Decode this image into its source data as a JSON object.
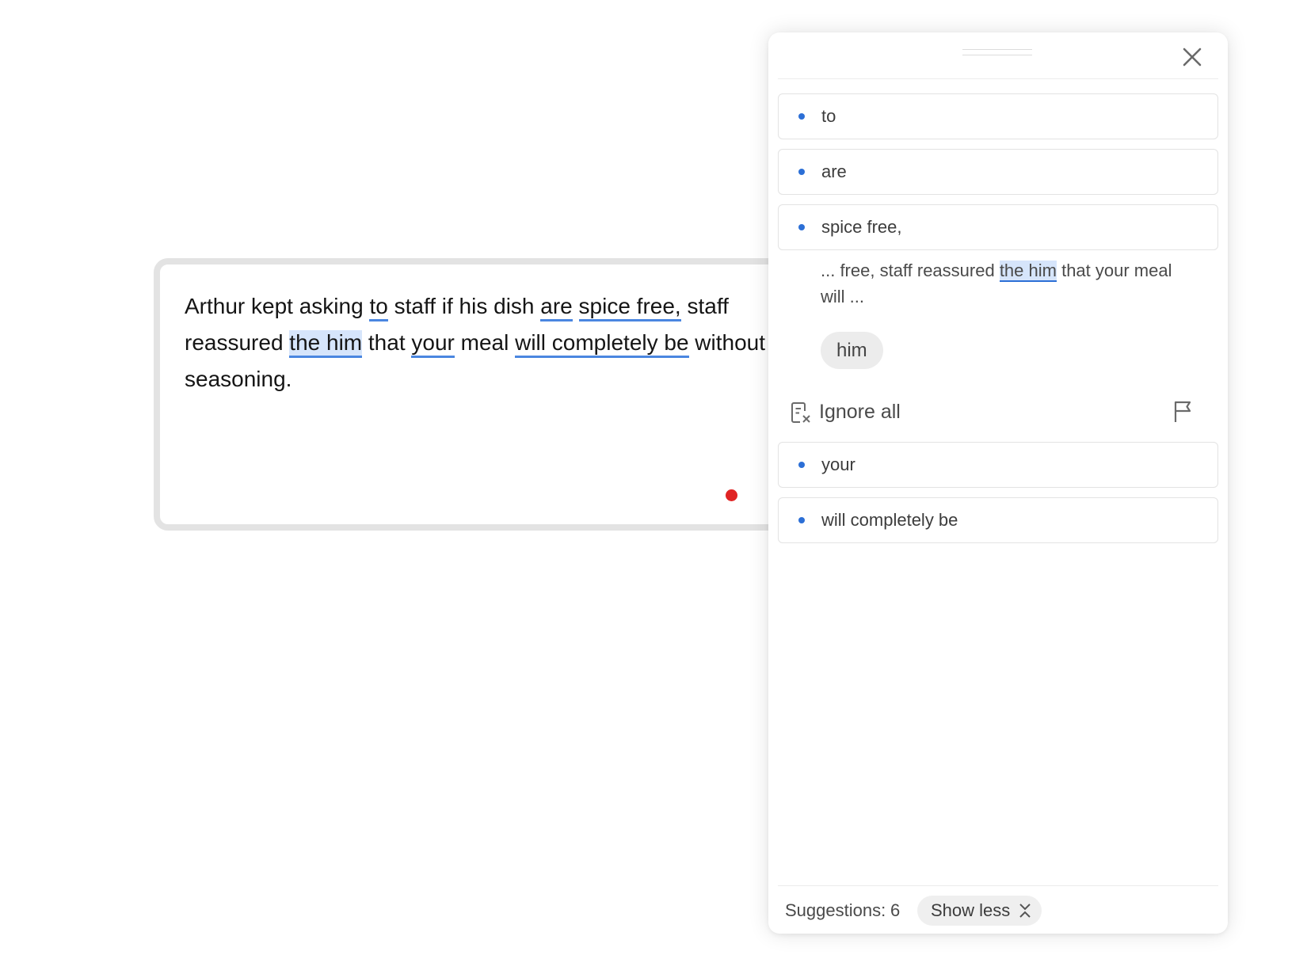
{
  "editor": {
    "text_parts": {
      "p1": "Arthur kept asking ",
      "m1": "to",
      "p2": " staff if his dish ",
      "m2": "are",
      "p3": " ",
      "m3": "spice free,",
      "p4": " staff reassured ",
      "m4": "the him",
      "p5": " that ",
      "m5": "your",
      "p6": " meal ",
      "m6": "will completely be",
      "p7": " without seasoning."
    }
  },
  "panel": {
    "suggestions": [
      {
        "label": "to"
      },
      {
        "label": "are"
      },
      {
        "label": "spice free,"
      },
      {
        "label": "your"
      },
      {
        "label": "will completely be"
      }
    ],
    "expanded": {
      "context_before": "... free, staff reassured ",
      "context_highlight": "the him",
      "context_after": " that your meal will ...",
      "replacement": "him",
      "ignore_all_label": "Ignore all"
    },
    "footer": {
      "suggestions_label": "Suggestions:",
      "suggestions_count": "6",
      "show_less_label": "Show less"
    }
  },
  "colors": {
    "accent": "#2c6fd6",
    "underline": "#4a86e0",
    "highlight": "#d6e5fb",
    "record_dot": "#e02424"
  },
  "icons": [
    "close-icon",
    "drag-handle-icon",
    "ignore-all-icon",
    "flag-icon",
    "collapse-icon"
  ]
}
